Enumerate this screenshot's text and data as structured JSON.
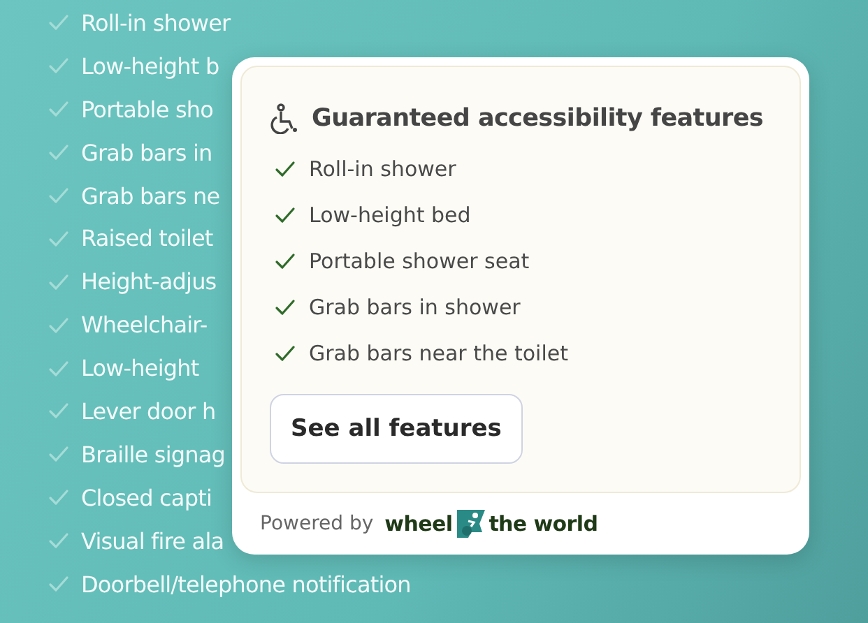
{
  "background_list": [
    {
      "label": "Roll-in shower"
    },
    {
      "label": "Low-height b"
    },
    {
      "label": "Portable sho"
    },
    {
      "label": "Grab bars in"
    },
    {
      "label": "Grab bars ne"
    },
    {
      "label": "Raised toilet"
    },
    {
      "label": "Height-adjus"
    },
    {
      "label": "Wheelchair-"
    },
    {
      "label": "Low-height"
    },
    {
      "label": "Lever door h"
    },
    {
      "label": "Braille signag"
    },
    {
      "label": "Closed capti"
    },
    {
      "label": "Visual fire ala"
    },
    {
      "label": "Doorbell/telephone notification"
    }
  ],
  "card": {
    "title": "Guaranteed accessibility features",
    "features": [
      "Roll-in shower",
      "Low-height bed",
      "Portable shower seat",
      "Grab bars in shower",
      "Grab bars near the toilet"
    ],
    "button": "See all features",
    "footer": {
      "prefix": "Powered by",
      "brand_left": "wheel",
      "brand_right": "the world"
    }
  }
}
